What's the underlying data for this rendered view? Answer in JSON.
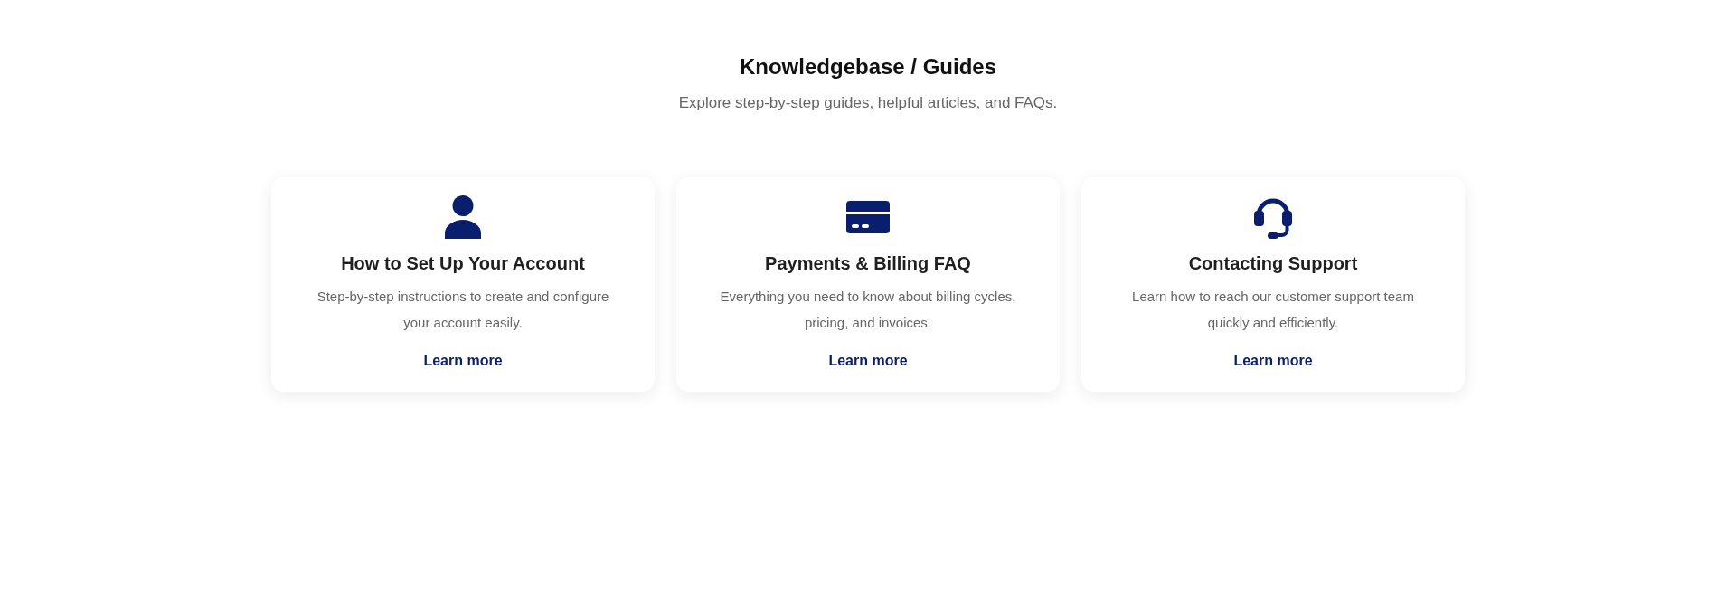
{
  "header": {
    "title": "Knowledgebase / Guides",
    "subtitle": "Explore step-by-step guides, helpful articles, and FAQs."
  },
  "cards": [
    {
      "kind": "person",
      "title": "How to Set Up Your Account",
      "description": "Step-by-step instructions to create and configure your account easily.",
      "link": "Learn more"
    },
    {
      "kind": "card",
      "title": "Payments & Billing FAQ",
      "description": "Everything you need to know about billing cycles, pricing, and invoices.",
      "link": "Learn more"
    },
    {
      "kind": "headset",
      "title": "Contacting Support",
      "description": "Learn how to reach our customer support team quickly and efficiently.",
      "link": "Learn more"
    }
  ]
}
